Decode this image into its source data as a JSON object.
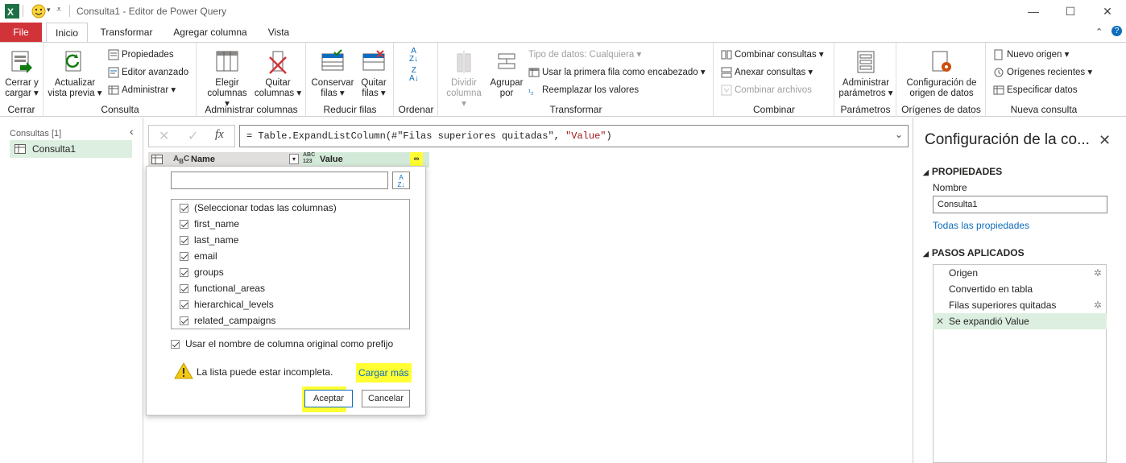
{
  "window": {
    "title": "Consulta1 - Editor de Power Query"
  },
  "tabs": [
    "File",
    "Inicio",
    "Transformar",
    "Agregar columna",
    "Vista"
  ],
  "ribbon": {
    "cerrar": {
      "btn1": "Cerrar y",
      "btn2": "cargar",
      "group": "Cerrar"
    },
    "consulta": {
      "act1": "Actualizar",
      "act2": "vista previa",
      "prop": "Propiedades",
      "editor": "Editor avanzado",
      "admin": "Administrar",
      "group": "Consulta"
    },
    "admincols": {
      "e1": "Elegir",
      "e2": "columnas",
      "q1": "Quitar",
      "q2": "columnas",
      "group": "Administrar columnas"
    },
    "reducir": {
      "c1": "Conservar",
      "c2": "filas",
      "q1": "Quitar",
      "q2": "filas",
      "group": "Reducir filas"
    },
    "ordenar": {
      "group": "Ordenar"
    },
    "transformar": {
      "d1": "Dividir",
      "d2": "columna",
      "a1": "Agrupar",
      "a2": "por",
      "tipo": "Tipo de datos: Cualquiera",
      "usar": "Usar la primera fila como encabezado",
      "reemp": "Reemplazar los valores",
      "group": "Transformar"
    },
    "combinar": {
      "comb": "Combinar consultas",
      "anex": "Anexar consultas",
      "arch": "Combinar archivos",
      "group": "Combinar"
    },
    "parametros": {
      "p1": "Administrar",
      "p2": "parámetros",
      "group": "Parámetros"
    },
    "origenes": {
      "o1": "Configuración de",
      "o2": "origen de datos",
      "group": "Orígenes de datos"
    },
    "nueva": {
      "nuevo": "Nuevo origen",
      "recientes": "Orígenes recientes",
      "especificar": "Especificar datos",
      "group": "Nueva consulta"
    }
  },
  "queries": {
    "label": "Consultas [1]",
    "item": "Consulta1"
  },
  "formula": {
    "prefix": "= Table.ExpandListColumn(#\"Filas superiores quitadas\", ",
    "str": "\"Value\"",
    "suffix": ")"
  },
  "columns": {
    "name": "Name",
    "value": "Value",
    "abc": "ABC",
    "n123": "123"
  },
  "popup": {
    "columns": [
      "(Seleccionar todas las columnas)",
      "first_name",
      "last_name",
      "email",
      "groups",
      "functional_areas",
      "hierarchical_levels",
      "related_campaigns"
    ],
    "prefix_label": "Usar el nombre de columna original como prefijo",
    "warning": "La lista puede estar incompleta.",
    "load_more": "Cargar más",
    "ok": "Aceptar",
    "cancel": "Cancelar"
  },
  "settings": {
    "title": "Configuración de la co...",
    "props_header": "PROPIEDADES",
    "name_label": "Nombre",
    "name_value": "Consulta1",
    "all_props": "Todas las propiedades",
    "steps_header": "PASOS APLICADOS",
    "steps": [
      "Origen",
      "Convertido en tabla",
      "Filas superiores quitadas",
      "Se expandió Value"
    ]
  },
  "colors": {
    "file_tab": "#d13438",
    "accent_green": "#dcefe0",
    "highlight": "#ffff33",
    "link": "#0f6cbd"
  }
}
